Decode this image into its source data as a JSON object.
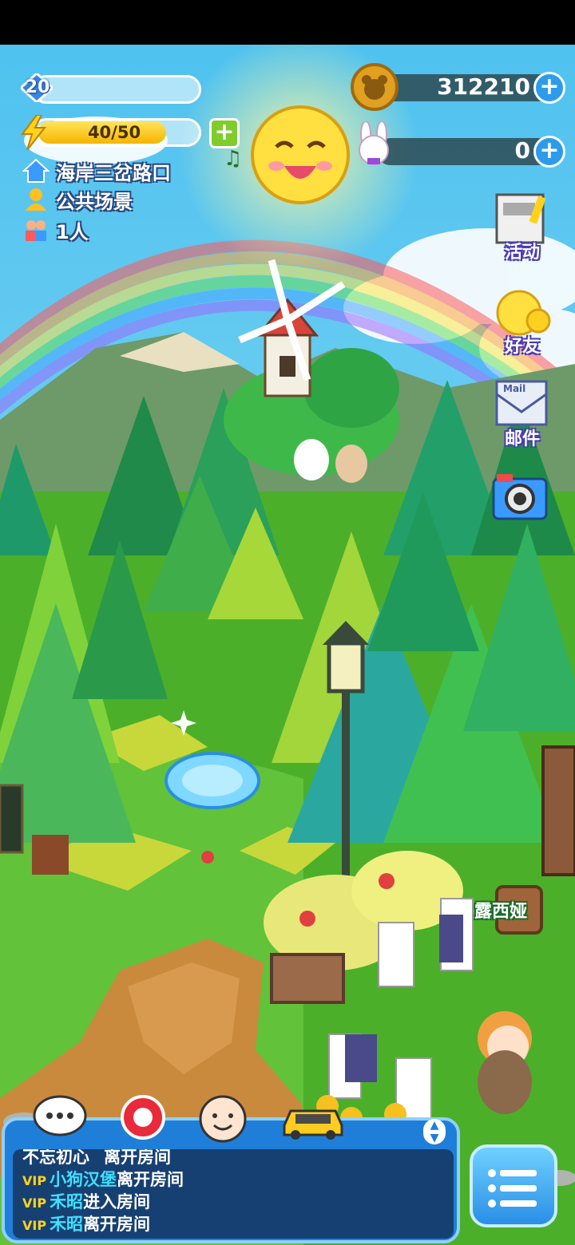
{
  "player": {
    "level": "20",
    "energy": "40/50",
    "energy_fraction": 0.8
  },
  "location": {
    "name": "海岸三岔路口",
    "scene_type": "公共场景",
    "players": "1人"
  },
  "currency": {
    "coins": "312210",
    "rabbit_tokens": "0"
  },
  "side_menu": {
    "events": "活动",
    "friends": "好友",
    "mail": "邮件",
    "mail_tag": "Mail"
  },
  "npc": {
    "name": "露西娅"
  },
  "chat": {
    "messages": [
      {
        "vip": "",
        "name": "不忘初心",
        "action": "离开房间"
      },
      {
        "vip": "VIP",
        "name": "小狗汉堡",
        "action": "离开房间"
      },
      {
        "vip": "VIP",
        "name": "禾昭",
        "action": "进入房间"
      },
      {
        "vip": "VIP",
        "name": "禾昭",
        "action": "离开房间"
      }
    ]
  },
  "colors": {
    "sky": "#5fc6ef",
    "grass": "#4caf2a",
    "chat_panel": "#1f7fd8",
    "coin": "#e0a020"
  }
}
